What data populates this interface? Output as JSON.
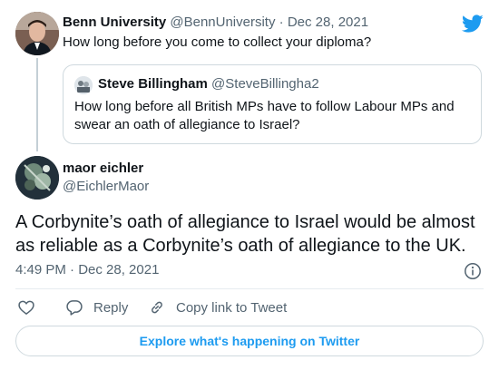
{
  "parent_tweet": {
    "name": "Benn University",
    "handle": "@BennUniversity",
    "separator": "·",
    "date": "Dec 28, 2021",
    "text": "How long before you come to collect your diploma?"
  },
  "quoted_tweet": {
    "name": "Steve Billingham",
    "handle": "@SteveBillingha2",
    "text": "How long before all British MPs have to follow Labour MPs and swear an oath of allegiance to Israel?"
  },
  "main_tweet": {
    "name": "maor eichler",
    "handle": "@EichlerMaor",
    "text": "A Corbynite’s oath of allegiance to Israel would be almost as reliable as a Corbynite’s oath of allegiance to the UK.",
    "timestamp": "4:49 PM · Dec 28, 2021"
  },
  "actions": {
    "reply_label": "Reply",
    "copy_label": "Copy link to Tweet"
  },
  "explore_label": "Explore what's happening on Twitter",
  "icons": {
    "brand": "twitter-bird-icon",
    "like": "heart-icon",
    "reply": "reply-bubble-icon",
    "copy": "link-icon",
    "info": "info-icon"
  },
  "colors": {
    "brand_blue": "#1d9bf0",
    "text_primary": "#0f1419",
    "text_secondary": "#536471",
    "border": "#cfd9de"
  }
}
